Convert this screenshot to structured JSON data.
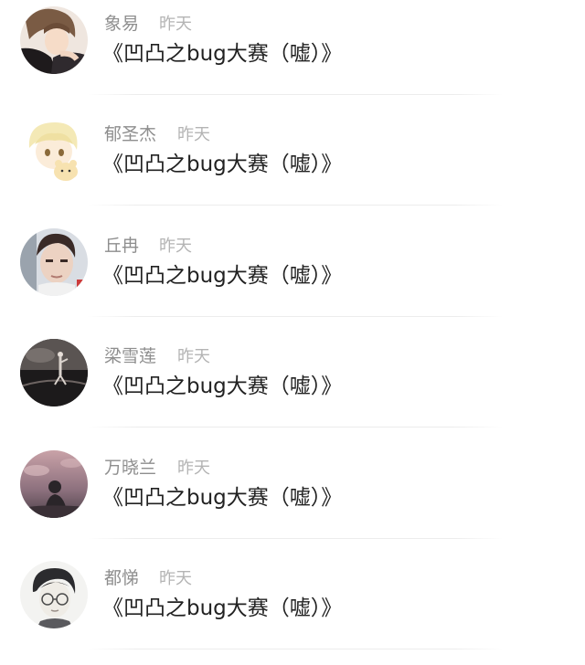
{
  "items": [
    {
      "name": "象易",
      "time": "昨天",
      "message": "《凹凸之bug大赛（嘘）》",
      "avatar": "anime-couple-avatar"
    },
    {
      "name": "郁圣杰",
      "time": "昨天",
      "message": "《凹凸之bug大赛（嘘）》",
      "avatar": "blonde-anime-boy-avatar"
    },
    {
      "name": "丘冉",
      "time": "昨天",
      "message": "《凹凸之bug大赛（嘘）》",
      "avatar": "selfie-boy-avatar"
    },
    {
      "name": "梁雪莲",
      "time": "昨天",
      "message": "《凹凸之bug大赛（嘘）》",
      "avatar": "night-scene-avatar"
    },
    {
      "name": "万晓兰",
      "time": "昨天",
      "message": "《凹凸之bug大赛（嘘）》",
      "avatar": "pink-sky-silhouette-avatar"
    },
    {
      "name": "都悌",
      "time": "昨天",
      "message": "《凹凸之bug大赛（嘘）》",
      "avatar": "glasses-sketch-avatar"
    }
  ]
}
